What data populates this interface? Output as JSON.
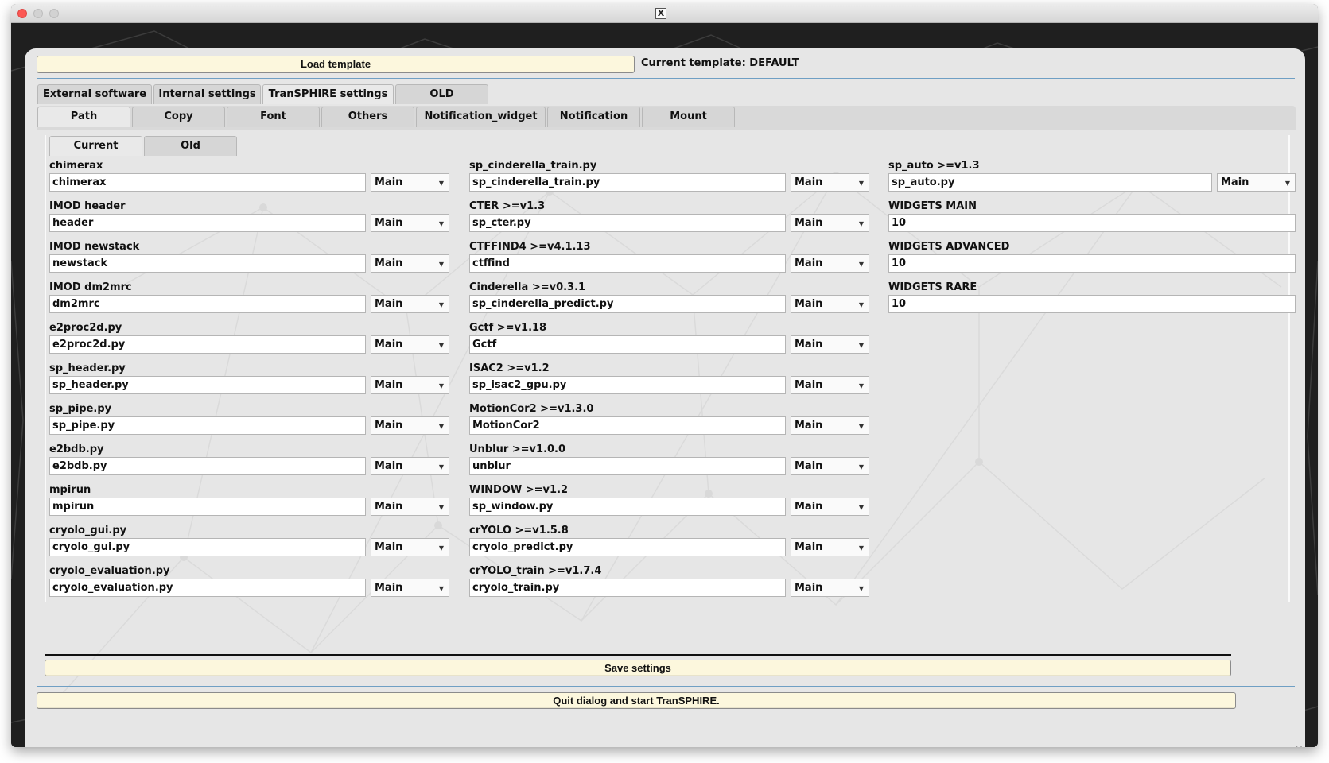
{
  "window": {
    "title_icon": "x11-icon"
  },
  "toolbar": {
    "load_template_label": "Load template",
    "current_template_text": "Current template: DEFAULT"
  },
  "top_tabs": [
    "External software",
    "Internal settings",
    "TranSPHIRE settings",
    "OLD"
  ],
  "top_tabs_active": "TranSPHIRE settings",
  "second_tabs": [
    "Path",
    "Copy",
    "Font",
    "Others",
    "Notification_widget",
    "Notification",
    "Mount"
  ],
  "second_tabs_active": "Path",
  "third_tabs": [
    "Current",
    "Old"
  ],
  "third_tabs_active": "Current",
  "columns": [
    {
      "fields": [
        {
          "label": "chimerax",
          "value": "chimerax",
          "mode": "Main"
        },
        {
          "label": "IMOD header",
          "value": "header",
          "mode": "Main"
        },
        {
          "label": "IMOD newstack",
          "value": "newstack",
          "mode": "Main"
        },
        {
          "label": "IMOD dm2mrc",
          "value": "dm2mrc",
          "mode": "Main"
        },
        {
          "label": "e2proc2d.py",
          "value": "e2proc2d.py",
          "mode": "Main"
        },
        {
          "label": "sp_header.py",
          "value": "sp_header.py",
          "mode": "Main"
        },
        {
          "label": "sp_pipe.py",
          "value": "sp_pipe.py",
          "mode": "Main"
        },
        {
          "label": "e2bdb.py",
          "value": "e2bdb.py",
          "mode": "Main"
        },
        {
          "label": "mpirun",
          "value": "mpirun",
          "mode": "Main"
        },
        {
          "label": "cryolo_gui.py",
          "value": "cryolo_gui.py",
          "mode": "Main"
        },
        {
          "label": "cryolo_evaluation.py",
          "value": "cryolo_evaluation.py",
          "mode": "Main"
        }
      ]
    },
    {
      "fields": [
        {
          "label": "sp_cinderella_train.py",
          "value": "sp_cinderella_train.py",
          "mode": "Main"
        },
        {
          "label": "CTER >=v1.3",
          "value": "sp_cter.py",
          "mode": "Main"
        },
        {
          "label": "CTFFIND4 >=v4.1.13",
          "value": "ctffind",
          "mode": "Main"
        },
        {
          "label": "Cinderella >=v0.3.1",
          "value": "sp_cinderella_predict.py",
          "mode": "Main"
        },
        {
          "label": "Gctf >=v1.18",
          "value": "Gctf",
          "mode": "Main"
        },
        {
          "label": "ISAC2 >=v1.2",
          "value": "sp_isac2_gpu.py",
          "mode": "Main"
        },
        {
          "label": "MotionCor2 >=v1.3.0",
          "value": "MotionCor2",
          "mode": "Main"
        },
        {
          "label": "Unblur >=v1.0.0",
          "value": "unblur",
          "mode": "Main"
        },
        {
          "label": "WINDOW >=v1.2",
          "value": "sp_window.py",
          "mode": "Main"
        },
        {
          "label": "crYOLO >=v1.5.8",
          "value": "cryolo_predict.py",
          "mode": "Main"
        },
        {
          "label": "crYOLO_train >=v1.7.4",
          "value": "cryolo_train.py",
          "mode": "Main"
        }
      ]
    },
    {
      "fields": [
        {
          "label": "sp_auto >=v1.3",
          "value": "sp_auto.py",
          "mode": "Main"
        },
        {
          "label": "WIDGETS MAIN",
          "value": "10",
          "mode": null
        },
        {
          "label": "WIDGETS ADVANCED",
          "value": "10",
          "mode": null
        },
        {
          "label": "WIDGETS RARE",
          "value": "10",
          "mode": null
        }
      ]
    }
  ],
  "footer": {
    "save_label": "Save settings",
    "quit_label": "Quit dialog and start TranSPHIRE."
  },
  "colors": {
    "button_bg": "#fcf7dd",
    "separator": "#6f9fc4",
    "panel_bg": "#e6e6e6"
  }
}
